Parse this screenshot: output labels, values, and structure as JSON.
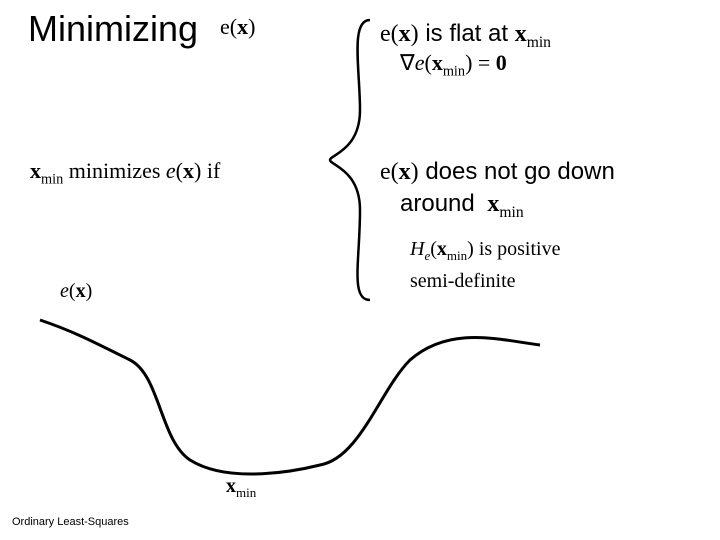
{
  "title": "Minimizing",
  "e_of_x": "e(x)",
  "flat_text": "is flat at",
  "x_min": "x",
  "x_min_sub": "min",
  "grad_expr": "∇e(x",
  "grad_close": ") = 0",
  "minimizes_pre": "x",
  "minimizes_mid": " minimizes ",
  "minimizes_post": "e(x)",
  "minimizes_if": " if",
  "down_text": "does not go down",
  "around_text": "around",
  "hessian_pre": "H",
  "hessian_sub": "e",
  "hessian_open": "(x",
  "hessian_close": ") is positive",
  "semidef": "semi-definite",
  "footer": "Ordinary Least-Squares"
}
